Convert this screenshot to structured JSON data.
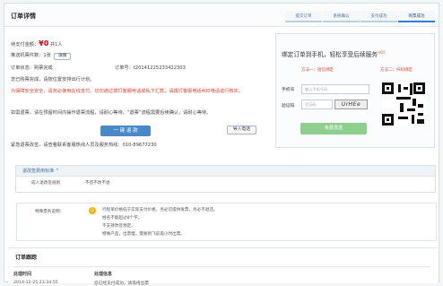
{
  "page": {
    "title": "订单详情"
  },
  "steps": [
    "提交订单",
    "系统确认",
    "支付成功",
    "购票成功"
  ],
  "order": {
    "amount_label": "待支付金额：",
    "amount": "¥0",
    "people": "共1人",
    "count_label": "推送机票件数：1张",
    "details_button": "详情",
    "status": "订单状态：购票完成",
    "order_no": "订单号：t20141225233422303",
    "tip": "您已购票完成，请按位置安排出行计划。",
    "warning": "为保障安全安全，请务必使用在线支付。切勿通过拨打客服电话或私下汇款，请拨打客服电话400电话进行核实。",
    "refund_note": "如需退票，请在预留时间内操作退票流程，请耐心等待，“退票”流程需要后续确认，请耐心等待。",
    "refund_button": "一 键 退 款",
    "export_button": "导入电话",
    "footer": "紧急退票改签，请查看联系客服热线人员及服务热线：010-89677230"
  },
  "bind": {
    "title": "绑定订单到手机，轻松享受后续服务",
    "hot": "HOT",
    "method_1": "方法一：短信绑定",
    "method_2": "方法二：扫码绑定",
    "phone_label": "手机号",
    "phone_placeholder": "输入手机号码",
    "code_label": "验证码",
    "code_placeholder": "验证码",
    "captcha": "UrHEe",
    "send_button": "免费发送"
  },
  "service": {
    "tag": "退改签费用标准 ^",
    "rule_label": "成人退改签规则",
    "rule_value": "不签不改不退"
  },
  "special": {
    "label": "特殊票务说明：",
    "lines": [
      "行程单价格低于实际支付价格，务必可提供发票，务必不退还。",
      "姓名不能超过8个字。",
      "不支持改签预定。",
      "特殊产品，出票慢，需要到飞前再小时出票。"
    ]
  },
  "tracking": {
    "title": "订单跟踪",
    "headers": [
      "处理时间",
      "处理信息"
    ],
    "time": "2014-12-25 23:34:55",
    "info": "您已经支付成功，请等待出票"
  }
}
